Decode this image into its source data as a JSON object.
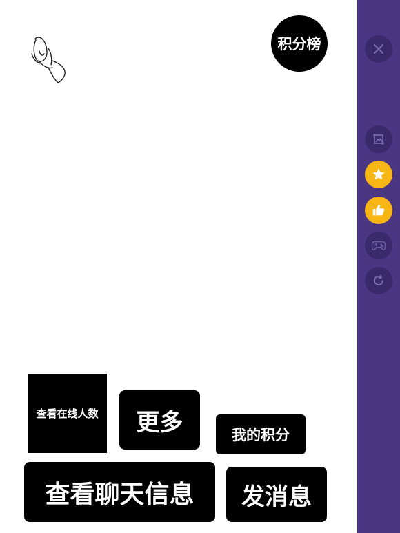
{
  "game": {
    "leaderboard_label": "积分榜",
    "buttons": {
      "online_count": "查看在线人数",
      "more": "更多",
      "my_points": "我的积分",
      "view_chat": "查看聊天信息",
      "send_message": "发消息"
    },
    "character_icon": "stick-figure-sketch"
  },
  "sidebar": {
    "background_color": "#4b3683",
    "buttons": [
      {
        "icon": "close-icon"
      },
      {
        "icon": "screenshot-icon"
      },
      {
        "icon": "star-icon",
        "color": "#f7b614"
      },
      {
        "icon": "thumbs-up-icon",
        "color": "#f7b614"
      },
      {
        "icon": "gamepad-icon"
      },
      {
        "icon": "refresh-icon"
      }
    ]
  }
}
